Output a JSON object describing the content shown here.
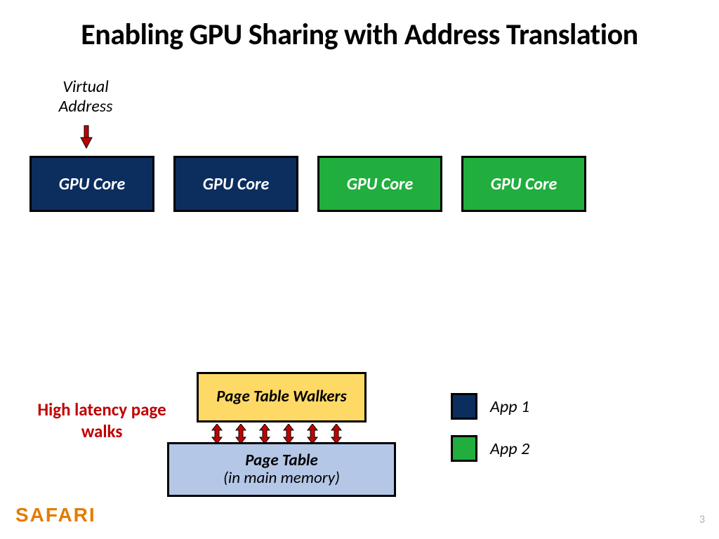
{
  "title": "Enabling GPU Sharing with Address Translation",
  "virtual_address_label": "Virtual Address",
  "cores": [
    {
      "label": "GPU Core",
      "app": "blue"
    },
    {
      "label": "GPU Core",
      "app": "blue"
    },
    {
      "label": "GPU Core",
      "app": "green"
    },
    {
      "label": "GPU Core",
      "app": "green"
    }
  ],
  "latency_note": "High latency page walks",
  "ptw_label": "Page Table Walkers",
  "pt_label": "Page Table",
  "pt_sub": "(in main memory)",
  "legend": {
    "app1": {
      "label": "App 1",
      "color": "blue"
    },
    "app2": {
      "label": "App 2",
      "color": "green"
    }
  },
  "brand": "SAFARI",
  "page_number": "3",
  "colors": {
    "blue": "#0b2e5e",
    "green": "#21ae3f",
    "yellow": "#ffd966",
    "lightblue": "#b4c7e7",
    "red_text": "#c00000",
    "brand": "#e47b00"
  }
}
